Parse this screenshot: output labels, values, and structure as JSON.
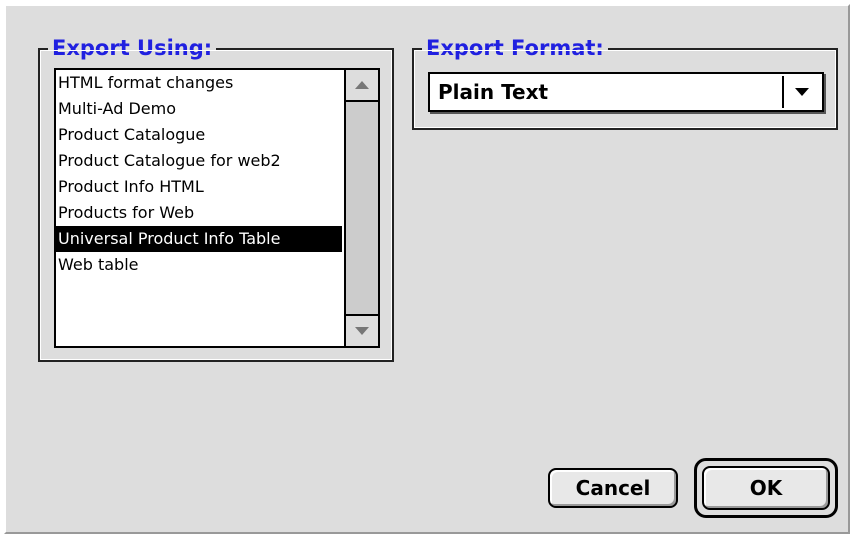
{
  "export_using": {
    "title": "Export Using:",
    "items": [
      "HTML format changes",
      "Multi-Ad Demo",
      "Product Catalogue",
      "Product Catalogue for web2",
      "Product Info HTML",
      "Products for Web",
      "Universal Product Info Table",
      "Web table"
    ],
    "selected_index": 6
  },
  "export_format": {
    "title": "Export Format:",
    "selected_value": "Plain Text"
  },
  "buttons": {
    "cancel_label": "Cancel",
    "ok_label": "OK"
  },
  "icons": {
    "scroll_up": "triangle-up-icon",
    "scroll_down": "triangle-down-icon",
    "popup_arrow": "triangle-down-icon"
  }
}
